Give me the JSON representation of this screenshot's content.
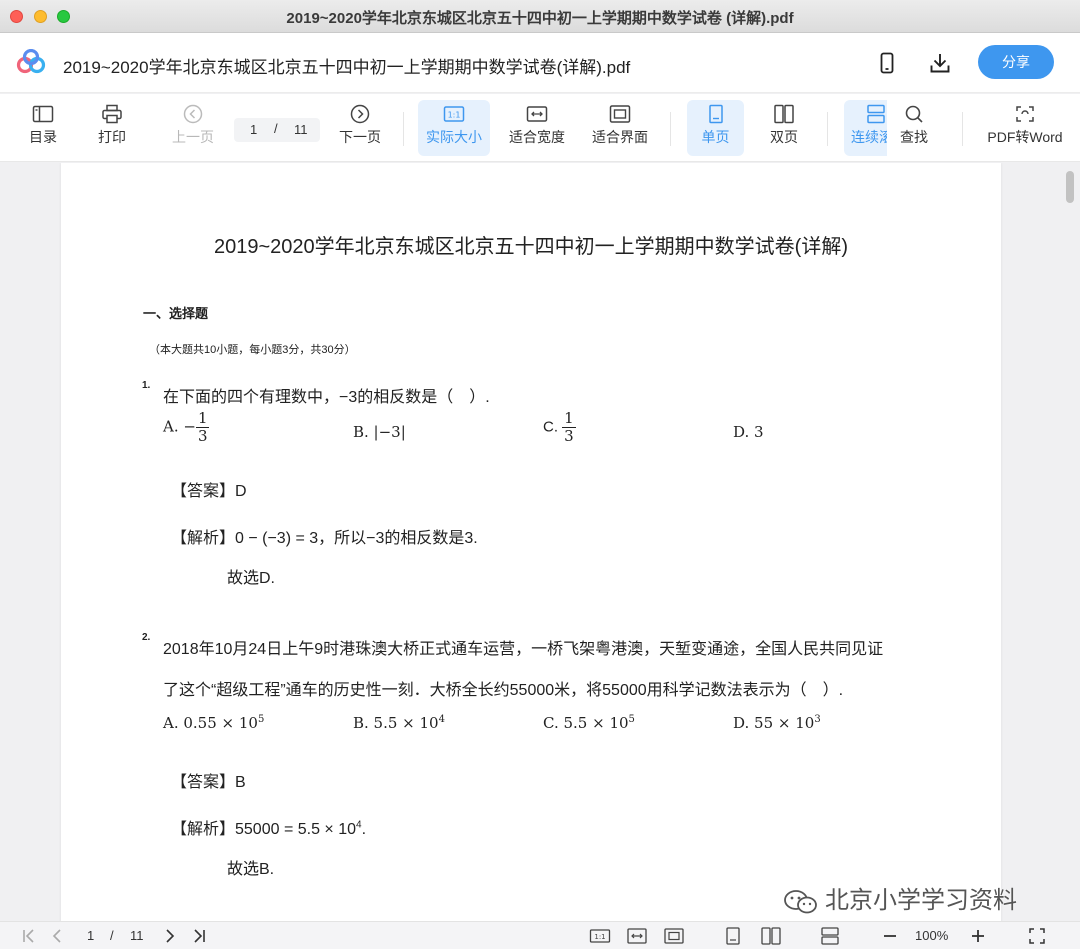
{
  "window": {
    "title": "2019~2020学年北京东城区北京五十四中初一上学期期中数学试卷 (详解).pdf"
  },
  "header": {
    "doc_title": "2019~2020学年北京东城区北京五十四中初一上学期期中数学试卷(详解).pdf",
    "share_label": "分享"
  },
  "toolbar": {
    "toc": "目录",
    "print": "打印",
    "prev": "上一页",
    "page_current": "1",
    "page_sep": "/",
    "page_total": "11",
    "next": "下一页",
    "actual_size": "实际大小",
    "fit_width": "适合宽度",
    "fit_page": "适合界面",
    "single_page": "单页",
    "double_page": "双页",
    "continuous": "连续滚",
    "search": "查找",
    "pdf_to_word": "PDF转Word"
  },
  "document": {
    "title": "2019~2020学年北京东城区北京五十四中初一上学期期中数学试卷(详解)",
    "section": "一、选择题",
    "section_note": "（本大题共10小题，每小题3分，共30分）",
    "q1": {
      "num": "1.",
      "text": "在下面的四个有理数中，−3的相反数是（　）.",
      "opt_a_prefix": "A. −",
      "opt_a_num": "1",
      "opt_a_den": "3",
      "opt_b": "B. |−3|",
      "opt_c_prefix": "C. ",
      "opt_c_num": "1",
      "opt_c_den": "3",
      "opt_d": "D. 3",
      "answer": "【答案】D",
      "analysis": "【解析】0 − (−3) = 3，所以−3的相反数是3.",
      "choose": "故选D."
    },
    "q2": {
      "num": "2.",
      "text_line1": "2018年10月24日上午9时港珠澳大桥正式通车运营，一桥飞架粤港澳，天堑变通途，全国人民共同见证",
      "text_line2": "了这个“超级工程”通车的历史性一刻．大桥全长约55000米，将55000用科学记数法表示为（　）.",
      "opt_a_base": "A. 0.55 × 10",
      "opt_a_exp": "5",
      "opt_b_base": "B. 5.5 × 10",
      "opt_b_exp": "4",
      "opt_c_base": "C. 5.5 × 10",
      "opt_c_exp": "5",
      "opt_d_base": "D. 55 × 10",
      "opt_d_exp": "3",
      "answer": "【答案】B",
      "analysis_base": "【解析】55000 = 5.5 × 10",
      "analysis_exp": "4",
      "analysis_end": ".",
      "choose": "故选B."
    }
  },
  "watermark": "北京小学学习资料",
  "bottombar": {
    "page_current": "1",
    "page_sep": "/",
    "page_total": "11",
    "zoom": "100%"
  },
  "colors": {
    "accent": "#3e97ef",
    "active_bg": "#e6f1fd"
  }
}
